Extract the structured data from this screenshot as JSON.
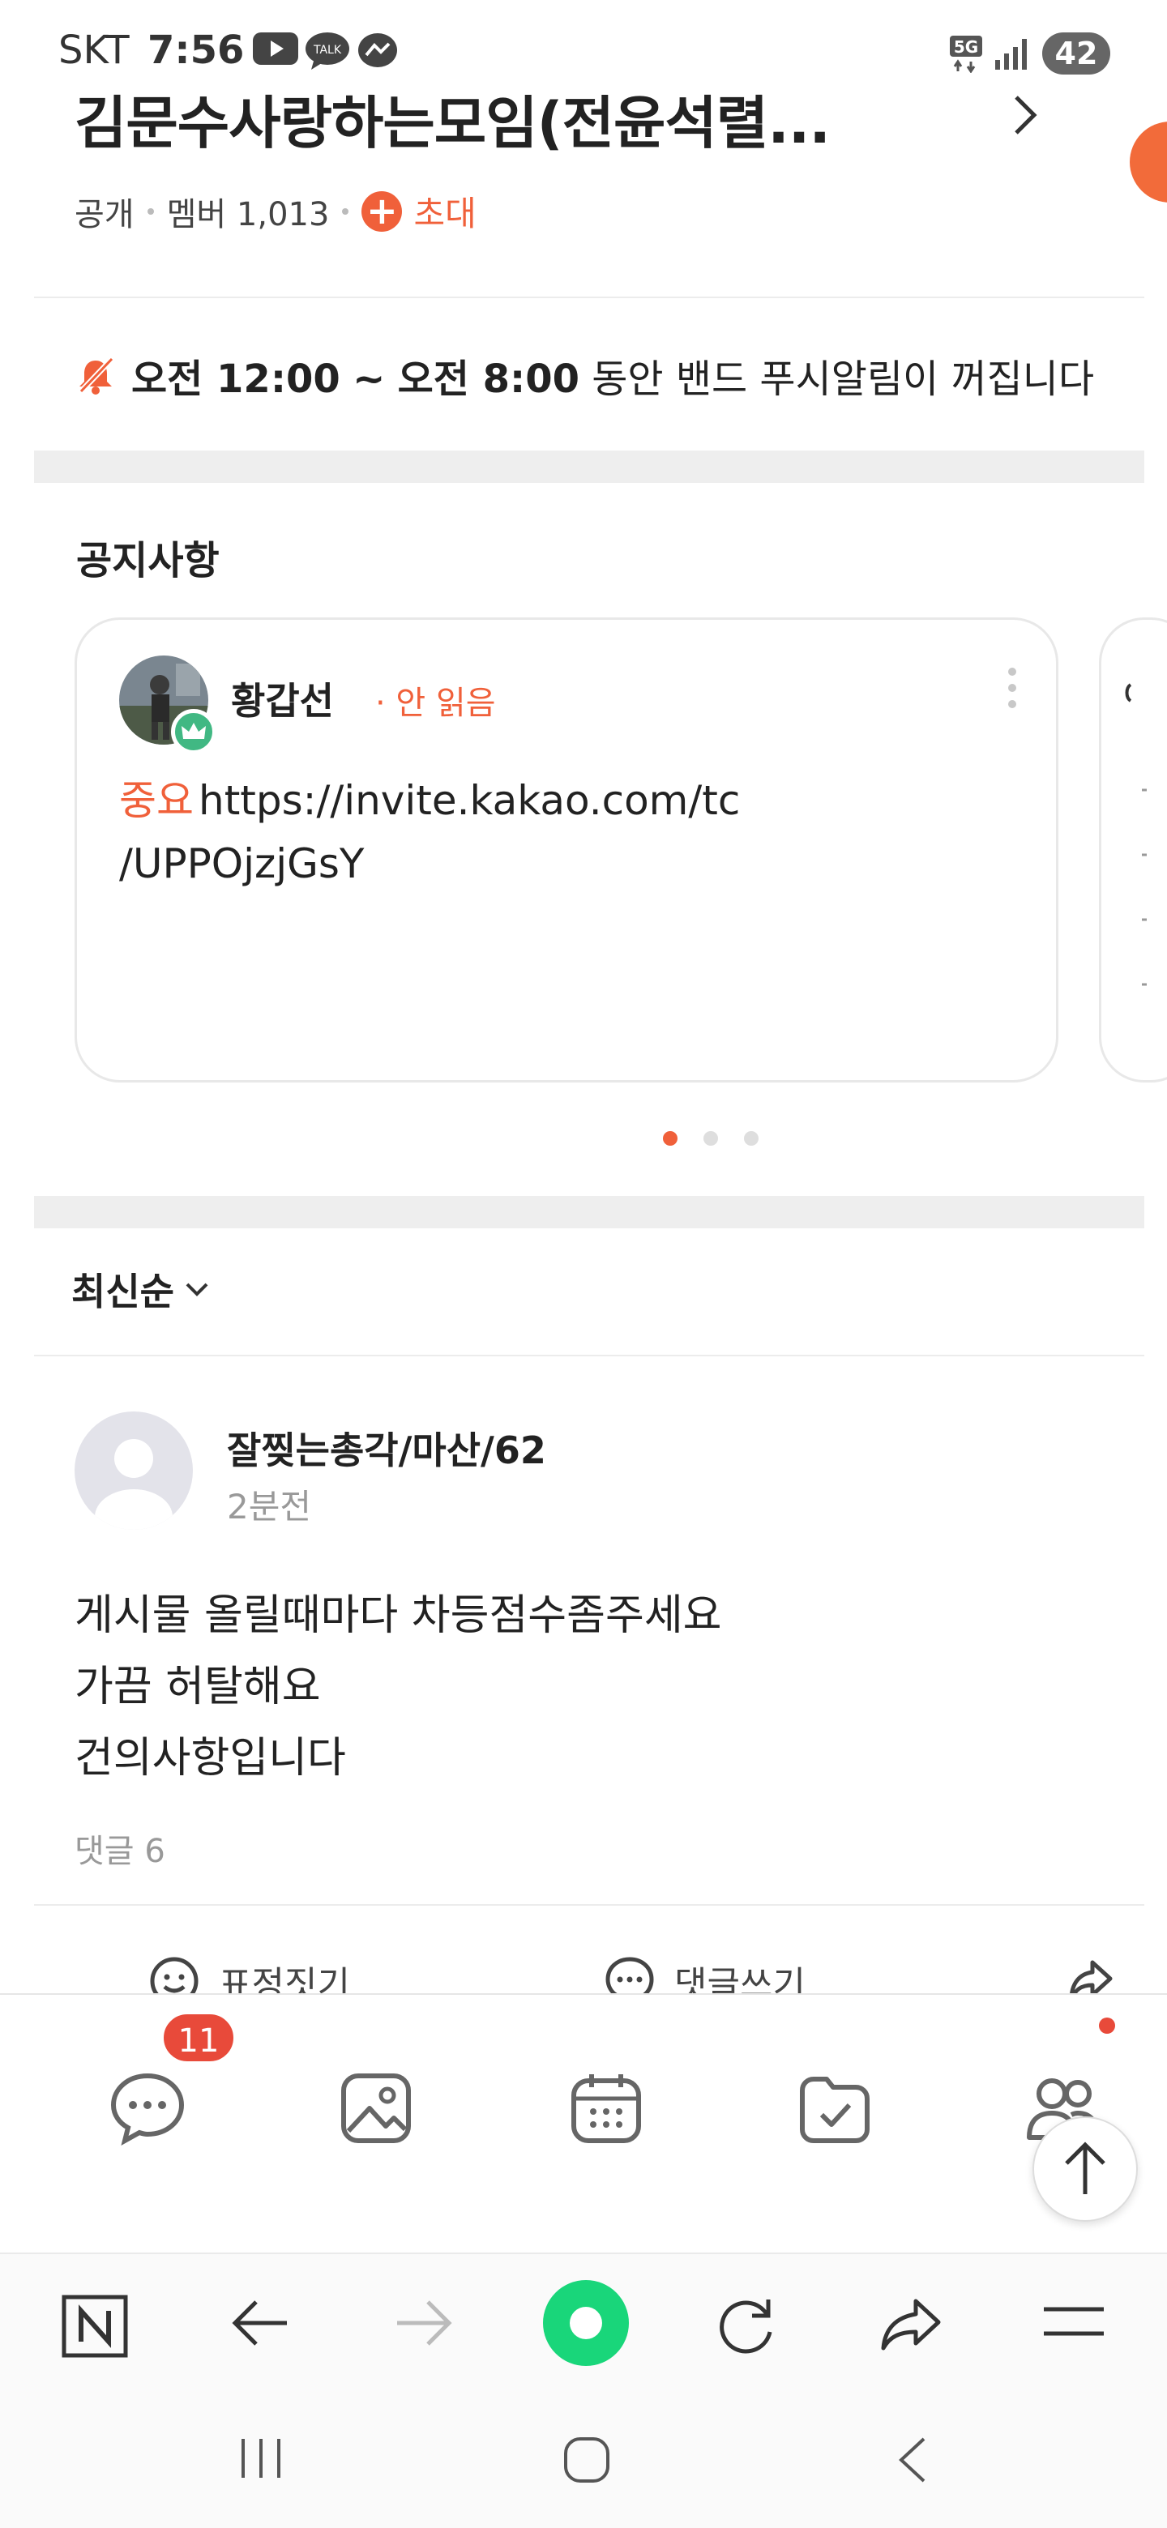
{
  "status_bar": {
    "carrier": "SKT",
    "time": "7:56",
    "network": "5G",
    "battery": "42",
    "icons": [
      "youtube-icon",
      "kakaotalk-icon",
      "messenger-icon",
      "signal-icon"
    ]
  },
  "header": {
    "title": "김문수사랑하는모임(전윤석렬...",
    "visibility": "공개",
    "members_label": "멤버 1,013",
    "invite_label": "초대"
  },
  "push_notice": {
    "start": "오전 12:00",
    "sep": "~",
    "end": "오전 8:00",
    "text": "동안 밴드 푸시알림이 꺼집니다"
  },
  "notices": {
    "section_title": "공지사항",
    "card": {
      "author": "황갑선",
      "status": "· 안 읽음",
      "tag": "중요",
      "body_line1": "https://invite.kakao.com/tc",
      "body_line2": "/UPPOjzjGsY"
    },
    "pages": 3,
    "active_page": 1
  },
  "sort": {
    "label": "최신순"
  },
  "post": {
    "author": "잘찢는총각/마산/62",
    "time": "2분전",
    "lines": [
      "게시물 올릴때마다 차등점수좀주세요",
      "가끔 허탈해요",
      "건의사항입니다"
    ],
    "comments": "댓글 6",
    "actions": {
      "react": "표정짓기",
      "comment": "댓글쓰기"
    }
  },
  "band_nav": {
    "chat_badge": "11",
    "items": [
      "chat",
      "photos",
      "calendar",
      "files",
      "members"
    ]
  },
  "browser_bar": {
    "items": [
      "naver",
      "back",
      "forward",
      "home",
      "refresh",
      "share",
      "menu"
    ]
  },
  "colors": {
    "accent": "#f0603a",
    "badge": "#e84a3a",
    "crown": "#41b883",
    "home": "#19d67a"
  }
}
